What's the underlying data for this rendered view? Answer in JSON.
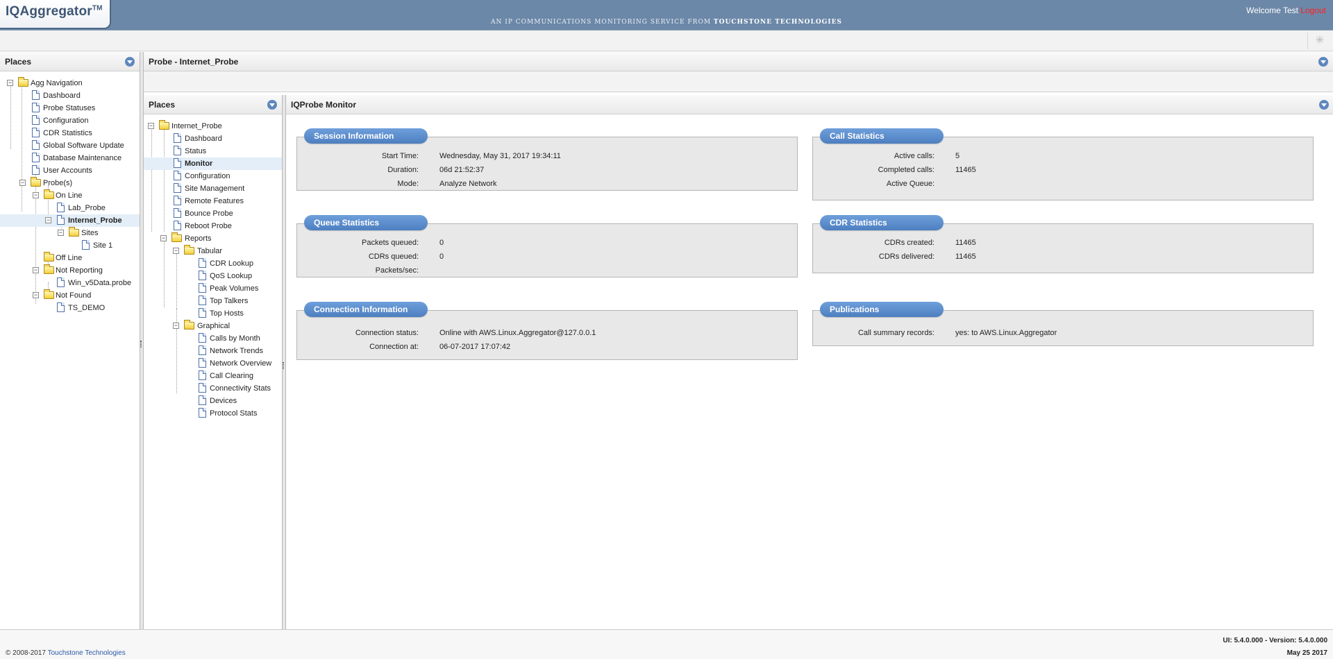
{
  "header": {
    "app_name": "IQAggregator",
    "trademark": "TM",
    "tagline_prefix": "AN IP COMMUNICATIONS MONITORING SERVICE FROM ",
    "tagline_brand": "TOUCHSTONE TECHNOLOGIES",
    "welcome": "Welcome Test",
    "logout_label": "Logout"
  },
  "left_panel": {
    "title": "Places",
    "tree": {
      "agg_navigation": "Agg Navigation",
      "dashboard": "Dashboard",
      "probe_statuses": "Probe Statuses",
      "configuration": "Configuration",
      "cdr_statistics": "CDR Statistics",
      "global_software_update": "Global Software Update",
      "database_maintenance": "Database Maintenance",
      "user_accounts": "User Accounts",
      "probes": "Probe(s)",
      "on_line": "On Line",
      "lab_probe": "Lab_Probe",
      "internet_probe": "Internet_Probe",
      "sites": "Sites",
      "site_1": "Site 1",
      "off_line": "Off Line",
      "not_reporting": "Not Reporting",
      "win_v5data": "Win_v5Data.probe",
      "not_found": "Not Found",
      "ts_demo": "TS_DEMO"
    }
  },
  "probe_panel": {
    "title": "Probe - Internet_Probe"
  },
  "places2": {
    "title": "Places",
    "tree": {
      "internet_probe": "Internet_Probe",
      "dashboard": "Dashboard",
      "status": "Status",
      "monitor": "Monitor",
      "configuration": "Configuration",
      "site_management": "Site Management",
      "remote_features": "Remote Features",
      "bounce_probe": "Bounce Probe",
      "reboot_probe": "Reboot Probe",
      "reports": "Reports",
      "tabular": "Tabular",
      "cdr_lookup": "CDR Lookup",
      "qos_lookup": "QoS Lookup",
      "peak_volumes": "Peak Volumes",
      "top_talkers": "Top Talkers",
      "top_hosts": "Top Hosts",
      "graphical": "Graphical",
      "calls_by_month": "Calls by Month",
      "network_trends": "Network Trends",
      "network_overview": "Network Overview",
      "call_clearing": "Call Clearing",
      "connectivity_stats": "Connectivity Stats",
      "devices": "Devices",
      "protocol_stats": "Protocol Stats"
    }
  },
  "monitor": {
    "title": "IQProbe Monitor",
    "session": {
      "title": "Session Information",
      "start_time_label": "Start Time:",
      "start_time": "Wednesday, May 31, 2017 19:34:11",
      "duration_label": "Duration:",
      "duration": "06d 21:52:37",
      "mode_label": "Mode:",
      "mode": "Analyze Network"
    },
    "queue": {
      "title": "Queue Statistics",
      "packets_queued_label": "Packets queued:",
      "packets_queued": "0",
      "cdrs_queued_label": "CDRs queued:",
      "cdrs_queued": "0",
      "packets_sec_label": "Packets/sec:",
      "packets_sec": ""
    },
    "connection": {
      "title": "Connection Information",
      "status_label": "Connection status:",
      "status": "Online with AWS.Linux.Aggregator@127.0.0.1",
      "at_label": "Connection at:",
      "at": "06-07-2017 17:07:42"
    },
    "call_stats": {
      "title": "Call Statistics",
      "active_calls_label": "Active calls:",
      "active_calls": "5",
      "completed_calls_label": "Completed calls:",
      "completed_calls": "11465",
      "active_queue_label": "Active Queue:",
      "active_queue": ""
    },
    "cdr_stats": {
      "title": "CDR Statistics",
      "created_label": "CDRs created:",
      "created": "11465",
      "delivered_label": "CDRs delivered:",
      "delivered": "11465"
    },
    "publications": {
      "title": "Publications",
      "csr_label": "Call summary records:",
      "csr": "yes: to AWS.Linux.Aggregator"
    }
  },
  "footer": {
    "copyright_prefix": "© 2008-2017 ",
    "copyright_link": "Touchstone Technologies",
    "version": "UI: 5.4.0.000 - Version: 5.4.0.000",
    "date": "May 25 2017"
  },
  "colors": {
    "header_bg": "#6c88a8",
    "card_title_bg": "#5b8dcf",
    "logout": "#ff2020",
    "selected_row": "#e4eef8"
  }
}
